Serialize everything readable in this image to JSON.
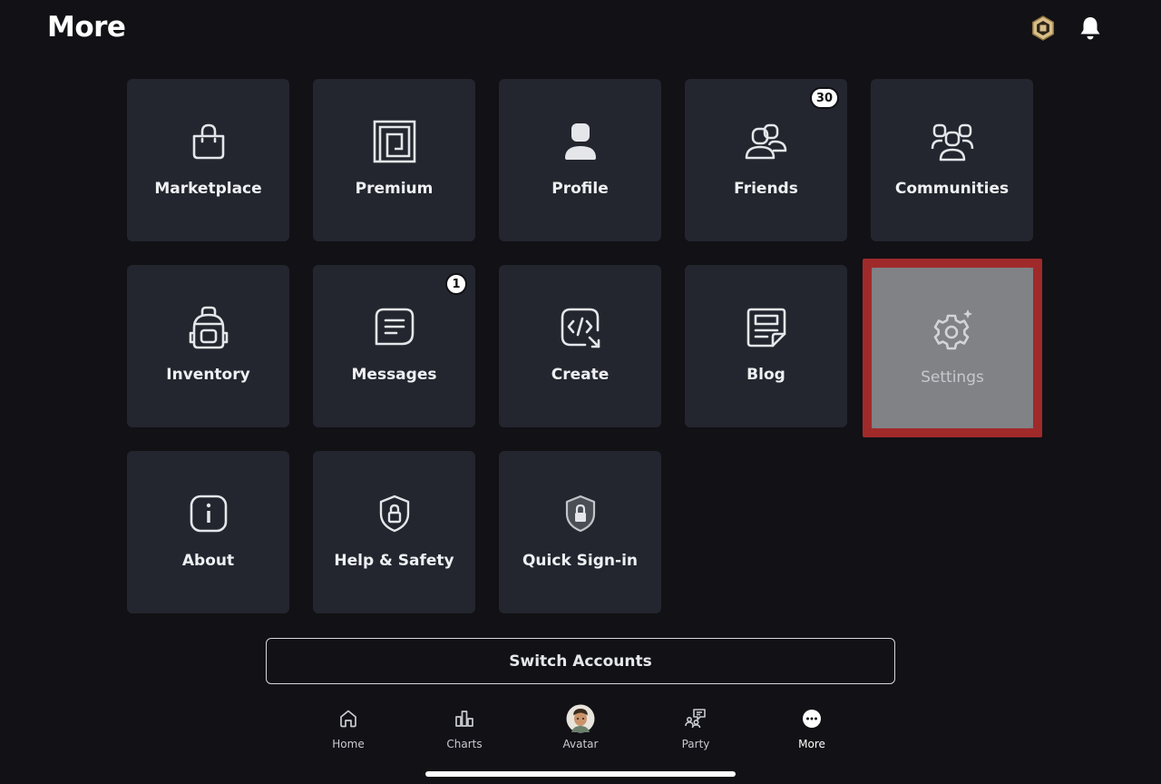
{
  "header": {
    "title": "More"
  },
  "icons": {
    "robux": "robux-coin-icon",
    "notifications": "bell-icon"
  },
  "tiles": [
    {
      "label": "Marketplace",
      "icon": "shopping-bag-icon"
    },
    {
      "label": "Premium",
      "icon": "premium-icon"
    },
    {
      "label": "Profile",
      "icon": "profile-icon"
    },
    {
      "label": "Friends",
      "icon": "friends-icon",
      "badge": "30"
    },
    {
      "label": "Communities",
      "icon": "communities-icon"
    },
    {
      "label": "Inventory",
      "icon": "backpack-icon"
    },
    {
      "label": "Messages",
      "icon": "message-icon",
      "badge": "1"
    },
    {
      "label": "Create",
      "icon": "code-icon"
    },
    {
      "label": "Blog",
      "icon": "blog-icon"
    },
    {
      "label": "Settings",
      "icon": "gear-icon"
    },
    {
      "label": "About",
      "icon": "info-icon"
    },
    {
      "label": "Help & Safety",
      "icon": "shield-lock-icon"
    },
    {
      "label": "Quick Sign-in",
      "icon": "shield-lock-filled-icon"
    }
  ],
  "switch_accounts": {
    "label": "Switch Accounts"
  },
  "bottom_nav": [
    {
      "label": "Home",
      "icon": "home-icon"
    },
    {
      "label": "Charts",
      "icon": "charts-icon"
    },
    {
      "label": "Avatar",
      "icon": "avatar-icon"
    },
    {
      "label": "Party",
      "icon": "party-icon"
    },
    {
      "label": "More",
      "icon": "more-icon",
      "active": true
    }
  ],
  "colors": {
    "background": "#111116",
    "tile": "#23262e",
    "highlight": "#a02a2a"
  }
}
